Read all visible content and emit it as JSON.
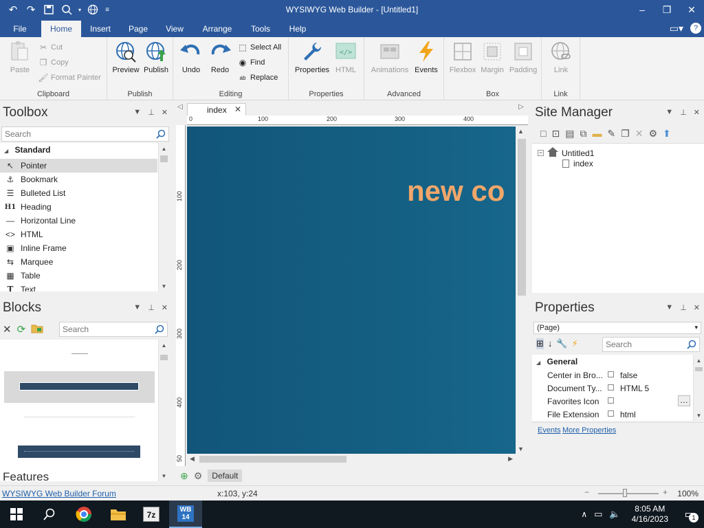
{
  "window": {
    "title": "WYSIWYG Web Builder - [Untitled1]"
  },
  "menu_tabs": [
    "File",
    "Home",
    "Insert",
    "Page",
    "View",
    "Arrange",
    "Tools",
    "Help"
  ],
  "ribbon": {
    "clipboard": {
      "label": "Clipboard",
      "paste": "Paste",
      "cut": "Cut",
      "copy": "Copy",
      "format_painter": "Format Painter"
    },
    "publish": {
      "label": "Publish",
      "preview": "Preview",
      "publish": "Publish"
    },
    "editing": {
      "label": "Editing",
      "undo": "Undo",
      "redo": "Redo",
      "select_all": "Select All",
      "find": "Find",
      "replace": "Replace"
    },
    "properties": {
      "label": "Properties",
      "properties": "Properties",
      "html": "HTML"
    },
    "advanced": {
      "label": "Advanced",
      "animations": "Animations",
      "events": "Events"
    },
    "box": {
      "label": "Box",
      "flexbox": "Flexbox",
      "margin": "Margin",
      "padding": "Padding"
    },
    "link": {
      "label": "Link",
      "link": "Link"
    }
  },
  "toolbox": {
    "title": "Toolbox",
    "search_placeholder": "Search",
    "category": "Standard",
    "items": [
      "Pointer",
      "Bookmark",
      "Bulleted List",
      "Heading",
      "Horizontal Line",
      "HTML",
      "Inline Frame",
      "Marquee",
      "Table",
      "Text"
    ]
  },
  "blocks": {
    "title": "Blocks",
    "search_placeholder": "Search",
    "features_label": "Features"
  },
  "editor": {
    "tab_label": "index",
    "ruler_h": [
      "0",
      "100",
      "200",
      "300",
      "400"
    ],
    "ruler_v": [
      "100",
      "200",
      "300",
      "400",
      "50"
    ],
    "canvas_text": "new co",
    "layer_label": "Default"
  },
  "site_manager": {
    "title": "Site Manager",
    "root": "Untitled1",
    "page": "index"
  },
  "properties": {
    "title": "Properties",
    "object": "(Page)",
    "search_placeholder": "Search",
    "section": "General",
    "rows": [
      {
        "name": "Center in Bro...",
        "value": "false"
      },
      {
        "name": "Document Ty...",
        "value": "HTML 5"
      },
      {
        "name": "Favorites Icon",
        "value": ""
      },
      {
        "name": "File Extension",
        "value": "html"
      }
    ],
    "events_link": "Events",
    "more_link": "More Properties"
  },
  "status": {
    "forum": "WYSIWYG Web Builder Forum",
    "coords": "x:103, y:24",
    "zoom": "100%"
  },
  "taskbar": {
    "time": "8:05 AM",
    "date": "4/16/2023",
    "notification_count": "1"
  },
  "colors": {
    "accent": "#2b579a",
    "canvas": "#145f82",
    "hero_text": "#f0a66a"
  }
}
